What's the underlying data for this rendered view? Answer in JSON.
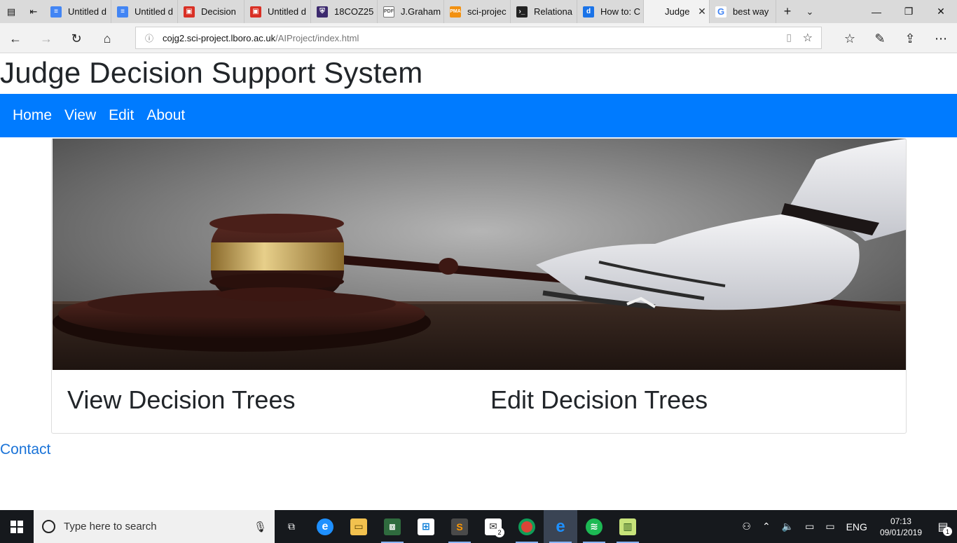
{
  "browser": {
    "tabs": [
      {
        "title": "Untitled d",
        "favicon": "docs-icon",
        "color": "#4285f4"
      },
      {
        "title": "Untitled d",
        "favicon": "docs-icon",
        "color": "#4285f4"
      },
      {
        "title": "Decision",
        "favicon": "slides-icon",
        "color": "#d93025"
      },
      {
        "title": "Untitled d",
        "favicon": "slides-icon",
        "color": "#d93025"
      },
      {
        "title": "18COZ25",
        "favicon": "shield-icon",
        "color": "#3c2a6e"
      },
      {
        "title": "J.Graham",
        "favicon": "pdf-icon",
        "color": "#555555"
      },
      {
        "title": "sci-projec",
        "favicon": "pma-icon",
        "color": "#f29111"
      },
      {
        "title": "Relationa",
        "favicon": "terminal-icon",
        "color": "#222222"
      },
      {
        "title": "How to: C",
        "favicon": "d-icon",
        "color": "#1a73e8"
      },
      {
        "title": "Judge",
        "favicon": "",
        "color": "",
        "active": true
      },
      {
        "title": "best way",
        "favicon": "google-icon",
        "color": "#4285f4"
      }
    ],
    "address": {
      "host": "cojg2.sci-project.lboro.ac.uk",
      "path": "/AIProject/index.html"
    }
  },
  "page": {
    "title": "Judge Decision Support System",
    "nav": [
      "Home",
      "View",
      "Edit",
      "About"
    ],
    "card": {
      "link_view": "View Decision Trees",
      "link_edit": "Edit Decision Trees"
    },
    "contact": "Contact",
    "brand_color": "#007bff"
  },
  "taskbar": {
    "search_placeholder": "Type here to search",
    "lang": "ENG",
    "time": "07:13",
    "date": "09/01/2019",
    "mail_badge": "2",
    "notif_badge": "1"
  }
}
